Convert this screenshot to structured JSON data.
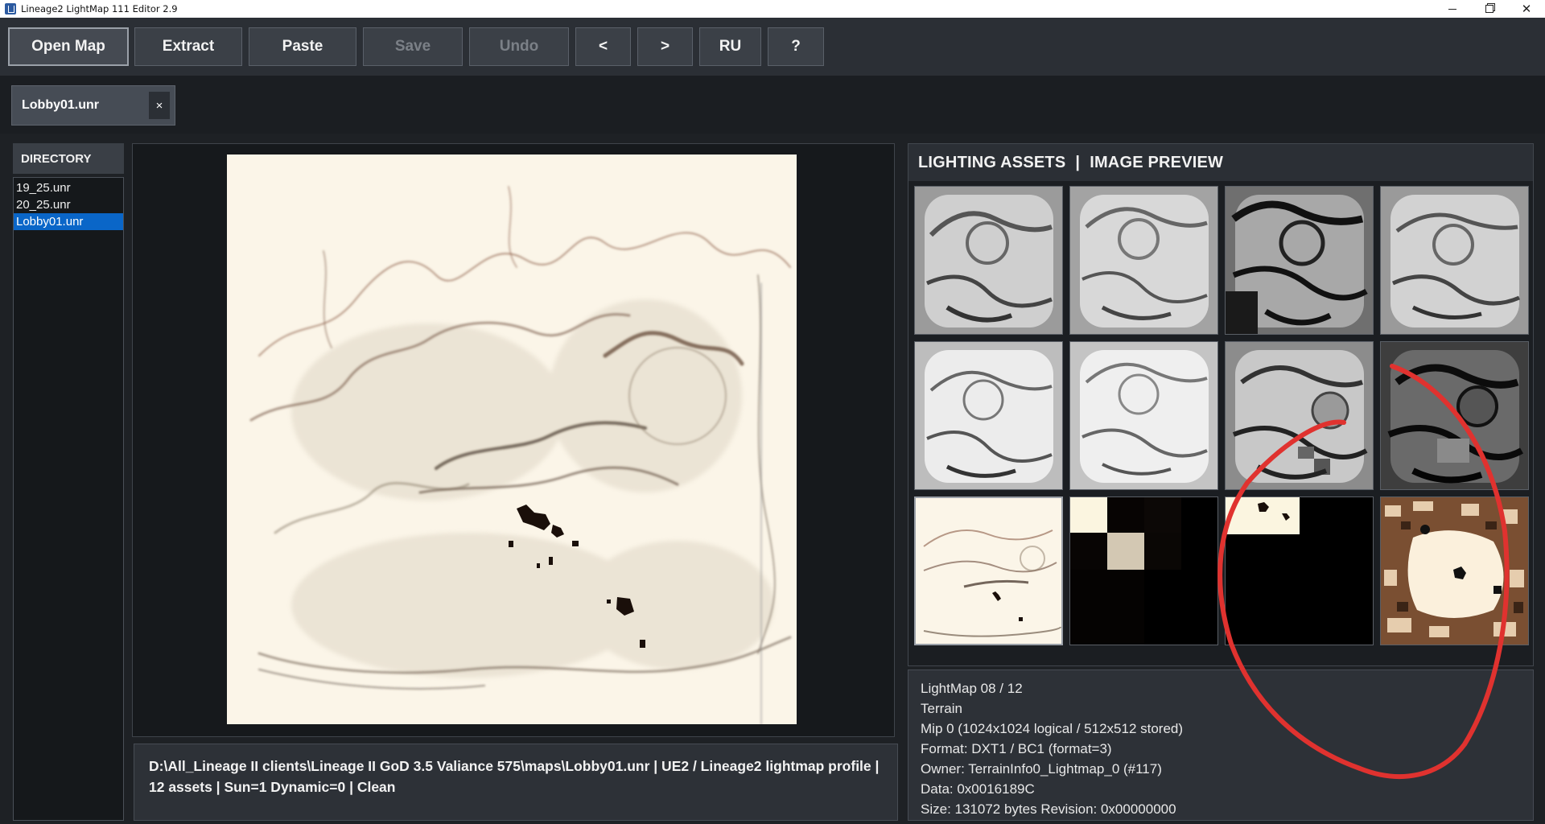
{
  "window": {
    "title": "Lineage2 LightMap 111 Editor 2.9",
    "controls": {
      "minimize": "minimize",
      "maximize": "maximize",
      "close": "✕"
    }
  },
  "toolbar": {
    "open_map": "Open Map",
    "extract": "Extract",
    "paste": "Paste",
    "save": "Save",
    "undo": "Undo",
    "prev": "<",
    "next": ">",
    "language": "RU",
    "help": "?"
  },
  "tabs": [
    {
      "label": "Lobby01.unr",
      "close": "×"
    }
  ],
  "directory": {
    "header": "DIRECTORY",
    "items": [
      "19_25.unr",
      "20_25.unr",
      "Lobby01.unr"
    ],
    "selected": "Lobby01.unr"
  },
  "status": {
    "text": "D:\\All_Lineage II clients\\Lineage II GoD 3.5 Valiance 575\\maps\\Lobby01.unr | UE2 / Lineage2 lightmap profile | 12 assets | Sun=1 Dynamic=0 | Clean"
  },
  "assets": {
    "header_left": "LIGHTING ASSETS",
    "separator": "|",
    "header_right": "IMAGE PREVIEW",
    "thumbnails": [
      {
        "style": "gray-relief-light"
      },
      {
        "style": "gray-relief-light"
      },
      {
        "style": "gray-relief-dark"
      },
      {
        "style": "gray-relief-light"
      },
      {
        "style": "gray-relief-soft"
      },
      {
        "style": "gray-relief-soft"
      },
      {
        "style": "gray-relief-mixed"
      },
      {
        "style": "gray-relief-black"
      },
      {
        "style": "cream-lightmap",
        "selected": true
      },
      {
        "style": "dark-blocks"
      },
      {
        "style": "black-corner"
      },
      {
        "style": "brown-noise"
      }
    ]
  },
  "info": {
    "lines": [
      "LightMap 08 / 12",
      "Terrain",
      "Mip 0 (1024x1024 logical / 512x512 stored)",
      "Format: DXT1 / BC1 (format=3)",
      "Owner: TerrainInfo0_Lightmap_0 (#117)",
      "Data: 0x0016189C",
      "Size: 131072 bytes Revision: 0x00000000"
    ]
  },
  "colors": {
    "accent_selection": "#0a66c8",
    "annotation_stroke": "#e0322f",
    "lightmap_base": "#fbf5e8"
  }
}
